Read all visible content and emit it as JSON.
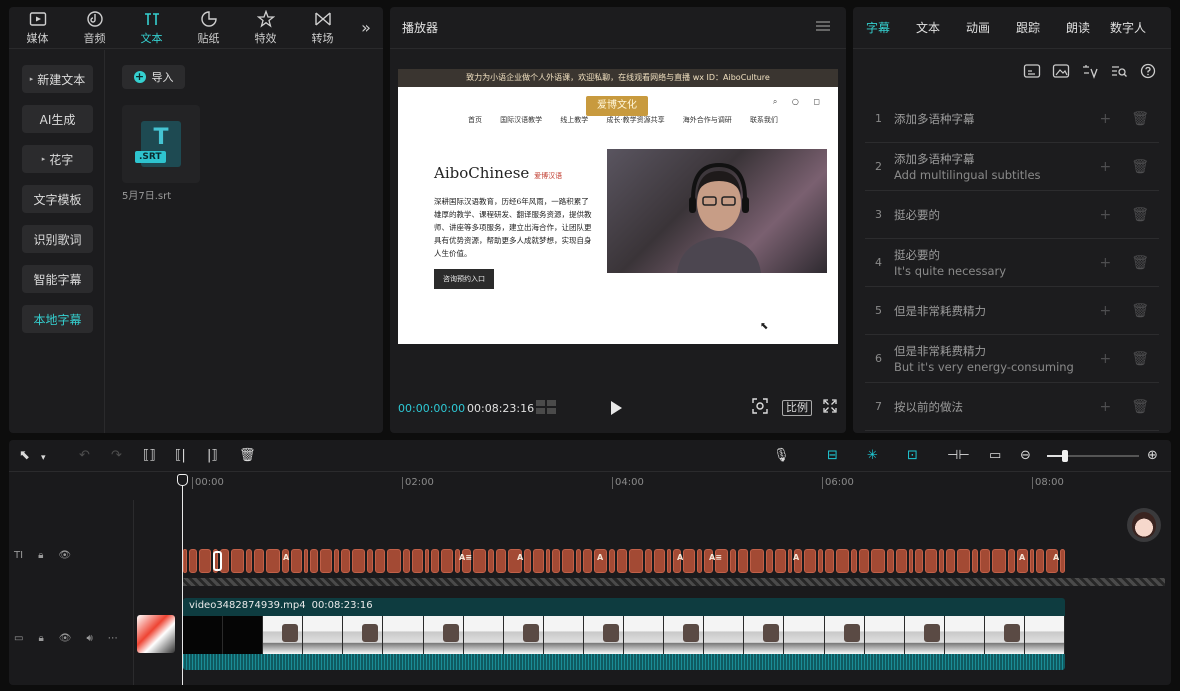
{
  "left_panel": {
    "tabs": [
      {
        "label": "媒体",
        "icon": "media-icon"
      },
      {
        "label": "音频",
        "icon": "audio-icon"
      },
      {
        "label": "文本",
        "icon": "text-icon"
      },
      {
        "label": "贴纸",
        "icon": "sticker-icon"
      },
      {
        "label": "特效",
        "icon": "effects-icon"
      },
      {
        "label": "转场",
        "icon": "transition-icon"
      }
    ],
    "more": "»",
    "menu": [
      {
        "label": "新建文本",
        "arrow": "▸"
      },
      {
        "label": "AI生成"
      },
      {
        "label": "花字",
        "arrow": "▸"
      },
      {
        "label": "文字模板"
      },
      {
        "label": "识别歌词"
      },
      {
        "label": "智能字幕"
      },
      {
        "label": "本地字幕"
      }
    ],
    "import_label": "导入",
    "file": {
      "tag": ".SRT",
      "glyph": "T",
      "name": "5月7日.srt"
    }
  },
  "player": {
    "title": "播放器",
    "current_time": "00:00:00:00",
    "total_time": "00:08:23:16",
    "ratio_label": "比例",
    "frame": {
      "topbar": "致力为小语企业做个人外语课，欢迎私聊，在线观看网络与直播 wx ID：AiboCulture",
      "logo": "爱博文化",
      "nav": [
        "首页",
        "国际汉语教学",
        "线上教学",
        "成长·教学资源共享",
        "海外合作与调研",
        "联系我们"
      ],
      "heading": "AiboChinese",
      "heading_tag": "爱博汉语",
      "paragraph": "深耕国际汉语教育，历经6年风雨，一路积累了雄厚的教学、课程研发、翻译服务资源，提供教师、讲座等多项服务，建立出海合作，让团队更具有优势资源，帮助更多人成就梦想，实现自身人生价值。",
      "button": "咨询预约入口"
    }
  },
  "subtitle_panel": {
    "tabs": [
      "字幕",
      "文本",
      "动画",
      "跟踪",
      "朗读",
      "数字人"
    ],
    "items": [
      {
        "num": "1",
        "zh": "添加多语种字幕",
        "en": ""
      },
      {
        "num": "2",
        "zh": "添加多语种字幕",
        "en": "Add multilingual subtitles"
      },
      {
        "num": "3",
        "zh": "挺必要的",
        "en": ""
      },
      {
        "num": "4",
        "zh": "挺必要的",
        "en": "It's quite necessary"
      },
      {
        "num": "5",
        "zh": "但是非常耗费精力",
        "en": ""
      },
      {
        "num": "6",
        "zh": "但是非常耗费精力",
        "en": "But it's very energy-consuming"
      },
      {
        "num": "7",
        "zh": "按以前的做法",
        "en": ""
      }
    ]
  },
  "timeline": {
    "ruler": [
      "00:00",
      "02:00",
      "04:00",
      "06:00",
      "08:00"
    ],
    "video_clip": {
      "name": "video3482874939.mp4",
      "duration": "00:08:23:16"
    },
    "sub_markers": [
      "A",
      "A≡",
      "A",
      "A",
      "A",
      "A≡",
      "A",
      "A",
      "A"
    ],
    "zoom_level": 0.2
  },
  "colors": {
    "accent": "#35d0d0",
    "subtitle_clip": "#a34a34",
    "video_clip": "#0e3c40"
  }
}
